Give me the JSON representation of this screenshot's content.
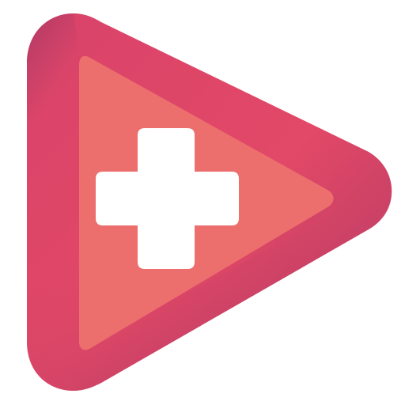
{
  "icon": {
    "name": "play-plus-icon",
    "colors": {
      "outer_light": "#e24867",
      "outer_mid": "#d9436a",
      "outer_dark": "#ae3a64",
      "inner": "#ec6f6e",
      "plus": "#ffffff"
    }
  }
}
